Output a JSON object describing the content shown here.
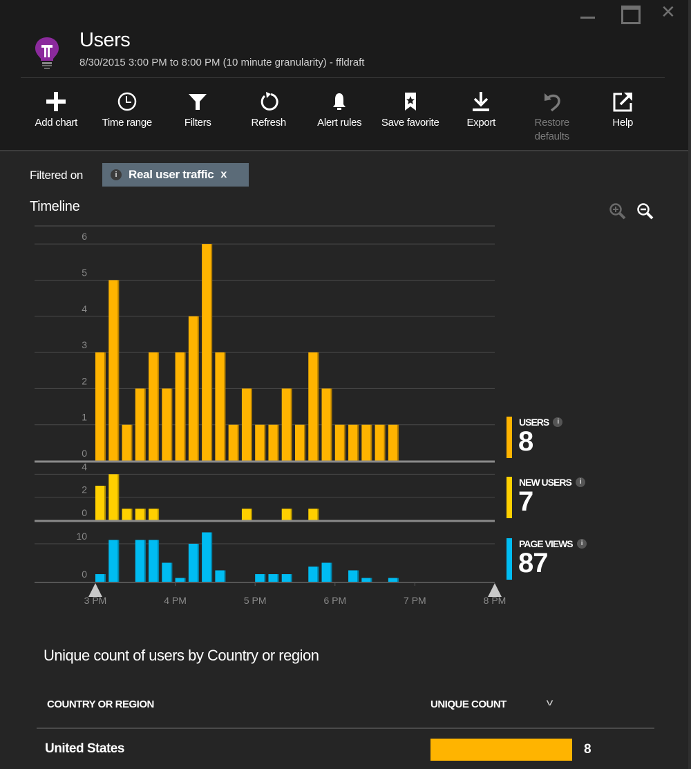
{
  "window": {
    "minimize_icon": "minimize-icon",
    "maximize_icon": "maximize-icon",
    "close_icon": "close-icon",
    "close_glyph": "✕"
  },
  "header": {
    "icon": "lightbulb-icon",
    "icon_color": "#8b2a9c",
    "title": "Users",
    "subtitle": "8/30/2015 3:00 PM to 8:00 PM (10 minute granularity) - ffldraft"
  },
  "toolbar": {
    "items": [
      {
        "id": "add-chart",
        "icon": "plus-icon",
        "label": "Add chart",
        "enabled": true
      },
      {
        "id": "time-range",
        "icon": "clock-icon",
        "label": "Time range",
        "enabled": true
      },
      {
        "id": "filters",
        "icon": "filter-icon",
        "label": "Filters",
        "enabled": true
      },
      {
        "id": "refresh",
        "icon": "refresh-icon",
        "label": "Refresh",
        "enabled": true
      },
      {
        "id": "alert-rules",
        "icon": "bell-icon",
        "label": "Alert rules",
        "enabled": true
      },
      {
        "id": "save-favorite",
        "icon": "bookmark-star-icon",
        "label": "Save favorite",
        "enabled": true
      },
      {
        "id": "export",
        "icon": "download-icon",
        "label": "Export",
        "enabled": true
      },
      {
        "id": "restore-defaults",
        "icon": "undo-icon",
        "label": "Restore defaults",
        "enabled": false
      },
      {
        "id": "help",
        "icon": "external-link-icon",
        "label": "Help",
        "enabled": true
      }
    ]
  },
  "filter": {
    "label": "Filtered on",
    "chip_info_glyph": "i",
    "chip_text": "Real user traffic",
    "chip_close": "x",
    "chip_color": "#5b6b78"
  },
  "timeline": {
    "title": "Timeline",
    "zoom_in_icon": "zoom-in-icon",
    "zoom_out_icon": "zoom-out-icon"
  },
  "colors": {
    "users": "#ffb400",
    "new_users": "#ffd000",
    "page_views": "#00bcf2",
    "background": "#252525",
    "header_bg": "#1b1b1b"
  },
  "chart_data": [
    {
      "type": "bar",
      "title": "Users",
      "x_start": "3:00 PM",
      "granularity_minutes": 10,
      "x_ticks": [
        "3 PM",
        "4 PM",
        "5 PM",
        "6 PM",
        "7 PM",
        "8 PM"
      ],
      "y_ticks": [
        0,
        1,
        2,
        3,
        4,
        5,
        6
      ],
      "ylim": [
        0,
        6.5
      ],
      "values": [
        3,
        5,
        1,
        2,
        3,
        2,
        3,
        4,
        6,
        3,
        1,
        2,
        1,
        1,
        2,
        1,
        3,
        2,
        1,
        1,
        1,
        1,
        1
      ],
      "color": "#ffb400",
      "grid": true
    },
    {
      "type": "bar",
      "title": "New users",
      "y_ticks": [
        0,
        2,
        4
      ],
      "ylim": [
        0,
        4.5
      ],
      "values": [
        3,
        4,
        1,
        1,
        1,
        0,
        0,
        0,
        0,
        0,
        0,
        1,
        0,
        0,
        1,
        0,
        1,
        0,
        0,
        0,
        0,
        0,
        0
      ],
      "color": "#ffd000",
      "grid": true
    },
    {
      "type": "bar",
      "title": "Page views",
      "y_ticks": [
        0,
        10
      ],
      "ylim": [
        0,
        14
      ],
      "values": [
        2,
        11,
        0,
        11,
        11,
        5,
        1,
        10,
        13,
        3,
        0,
        0,
        2,
        2,
        2,
        0,
        4,
        5,
        0,
        3,
        1,
        0,
        1
      ],
      "color": "#00bcf2",
      "grid": true
    }
  ],
  "kpis": [
    {
      "label": "USERS",
      "value": "8",
      "color": "#ffb400"
    },
    {
      "label": "NEW USERS",
      "value": "7",
      "color": "#ffd000"
    },
    {
      "label": "PAGE VIEWS",
      "value": "87",
      "color": "#00bcf2"
    }
  ],
  "grid": {
    "title": "Unique count of users by Country or region",
    "columns": [
      "COUNTRY OR REGION",
      "UNIQUE COUNT"
    ],
    "sort_glyph": "v",
    "rows": [
      {
        "country": "United States",
        "count": "8",
        "fraction": 1.0
      }
    ]
  }
}
